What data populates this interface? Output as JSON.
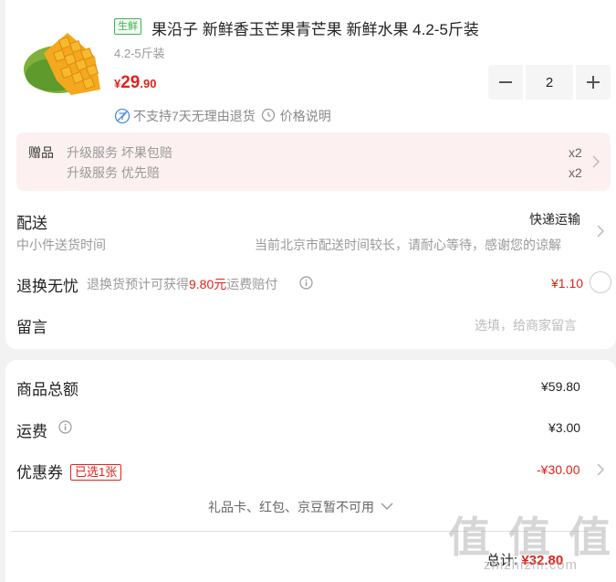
{
  "product": {
    "tag": "生鲜",
    "title": "果沿子 新鲜香玉芒果青芒果 新鲜水果 4.2-5斤装",
    "spec": "4.2-5斤装",
    "price_symbol": "¥",
    "price_int": "29",
    "price_dec": ".90",
    "quantity": "2",
    "no_return": "不支持7天无理由退货",
    "price_info": "价格说明"
  },
  "gift": {
    "label": "赠品",
    "items": [
      {
        "name": "升级服务 坏果包赔",
        "qty": "x2"
      },
      {
        "name": "升级服务 优先赔",
        "qty": "x2"
      }
    ]
  },
  "delivery": {
    "title": "配送",
    "method": "快递运输",
    "sub_left": "中小件送货时间",
    "sub_right": "当前北京市配送时间较长，请耐心等待，感谢您的谅解"
  },
  "return_worry": {
    "title": "退换无忧",
    "desc_prefix": "退换货预计可获得",
    "desc_amount": "9.80元",
    "desc_suffix": "运费赔付",
    "price": "¥1.10"
  },
  "message": {
    "title": "留言",
    "placeholder": "选填，给商家留言"
  },
  "summary": {
    "goods_label": "商品总额",
    "goods_value": "¥59.80",
    "freight_label": "运费",
    "freight_value": "¥3.00",
    "coupon_label": "优惠券",
    "coupon_badge": "已选1张",
    "coupon_value": "-¥30.00",
    "unavailable": "礼品卡、红包、京豆暂不可用",
    "total_label": "总计:",
    "total_value": "¥32.80"
  },
  "watermark": {
    "text": "值 值 值",
    "site": "zhizhizhi.com"
  },
  "colors": {
    "accent_red": "#e2231a",
    "fresh_green": "#3fb24f",
    "gift_bg": "#fdf0f0"
  }
}
